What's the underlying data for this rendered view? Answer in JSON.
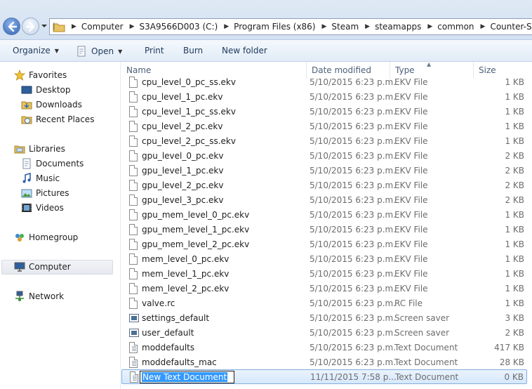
{
  "address": {
    "crumbs": [
      "Computer",
      "S3A9566D003 (C:)",
      "Program Files (x86)",
      "Steam",
      "steamapps",
      "common",
      "Counter-Strike Global O"
    ]
  },
  "toolbar": {
    "organize": "Organize",
    "open": "Open",
    "print": "Print",
    "burn": "Burn",
    "new_folder": "New folder"
  },
  "nav": {
    "favorites": "Favorites",
    "desktop": "Desktop",
    "downloads": "Downloads",
    "recent_places": "Recent Places",
    "libraries": "Libraries",
    "documents": "Documents",
    "music": "Music",
    "pictures": "Pictures",
    "videos": "Videos",
    "homegroup": "Homegroup",
    "computer": "Computer",
    "network": "Network"
  },
  "columns": {
    "name": "Name",
    "date": "Date modified",
    "type": "Type",
    "size": "Size"
  },
  "files": [
    {
      "name": "cpu_level_0_pc_ss.ekv",
      "date": "5/10/2015 6:23 p.m.",
      "type": "EKV File",
      "size": "1 KB",
      "icon": "doc-icon"
    },
    {
      "name": "cpu_level_1_pc.ekv",
      "date": "5/10/2015 6:23 p.m.",
      "type": "EKV File",
      "size": "1 KB",
      "icon": "doc-icon"
    },
    {
      "name": "cpu_level_1_pc_ss.ekv",
      "date": "5/10/2015 6:23 p.m.",
      "type": "EKV File",
      "size": "1 KB",
      "icon": "doc-icon"
    },
    {
      "name": "cpu_level_2_pc.ekv",
      "date": "5/10/2015 6:23 p.m.",
      "type": "EKV File",
      "size": "1 KB",
      "icon": "doc-icon"
    },
    {
      "name": "cpu_level_2_pc_ss.ekv",
      "date": "5/10/2015 6:23 p.m.",
      "type": "EKV File",
      "size": "1 KB",
      "icon": "doc-icon"
    },
    {
      "name": "gpu_level_0_pc.ekv",
      "date": "5/10/2015 6:23 p.m.",
      "type": "EKV File",
      "size": "2 KB",
      "icon": "doc-icon"
    },
    {
      "name": "gpu_level_1_pc.ekv",
      "date": "5/10/2015 6:23 p.m.",
      "type": "EKV File",
      "size": "2 KB",
      "icon": "doc-icon"
    },
    {
      "name": "gpu_level_2_pc.ekv",
      "date": "5/10/2015 6:23 p.m.",
      "type": "EKV File",
      "size": "2 KB",
      "icon": "doc-icon"
    },
    {
      "name": "gpu_level_3_pc.ekv",
      "date": "5/10/2015 6:23 p.m.",
      "type": "EKV File",
      "size": "2 KB",
      "icon": "doc-icon"
    },
    {
      "name": "gpu_mem_level_0_pc.ekv",
      "date": "5/10/2015 6:23 p.m.",
      "type": "EKV File",
      "size": "1 KB",
      "icon": "doc-icon"
    },
    {
      "name": "gpu_mem_level_1_pc.ekv",
      "date": "5/10/2015 6:23 p.m.",
      "type": "EKV File",
      "size": "1 KB",
      "icon": "doc-icon"
    },
    {
      "name": "gpu_mem_level_2_pc.ekv",
      "date": "5/10/2015 6:23 p.m.",
      "type": "EKV File",
      "size": "1 KB",
      "icon": "doc-icon"
    },
    {
      "name": "mem_level_0_pc.ekv",
      "date": "5/10/2015 6:23 p.m.",
      "type": "EKV File",
      "size": "1 KB",
      "icon": "doc-icon"
    },
    {
      "name": "mem_level_1_pc.ekv",
      "date": "5/10/2015 6:23 p.m.",
      "type": "EKV File",
      "size": "1 KB",
      "icon": "doc-icon"
    },
    {
      "name": "mem_level_2_pc.ekv",
      "date": "5/10/2015 6:23 p.m.",
      "type": "EKV File",
      "size": "1 KB",
      "icon": "doc-icon"
    },
    {
      "name": "valve.rc",
      "date": "5/10/2015 6:23 p.m.",
      "type": "RC File",
      "size": "1 KB",
      "icon": "doc-icon"
    },
    {
      "name": "settings_default",
      "date": "5/10/2015 6:23 p.m.",
      "type": "Screen saver",
      "size": "3 KB",
      "icon": "screensaver-icon"
    },
    {
      "name": "user_default",
      "date": "5/10/2015 6:23 p.m.",
      "type": "Screen saver",
      "size": "2 KB",
      "icon": "screensaver-icon"
    },
    {
      "name": "moddefaults",
      "date": "5/10/2015 6:23 p.m.",
      "type": "Text Document",
      "size": "417 KB",
      "icon": "text-doc-icon"
    },
    {
      "name": "moddefaults_mac",
      "date": "5/10/2015 6:23 p.m.",
      "type": "Text Document",
      "size": "28 KB",
      "icon": "text-doc-icon"
    }
  ],
  "new_file": {
    "name": "New Text Document",
    "date": "11/11/2015 7:58 p....",
    "type": "Text Document",
    "size": "0 KB",
    "icon": "text-doc-icon"
  }
}
